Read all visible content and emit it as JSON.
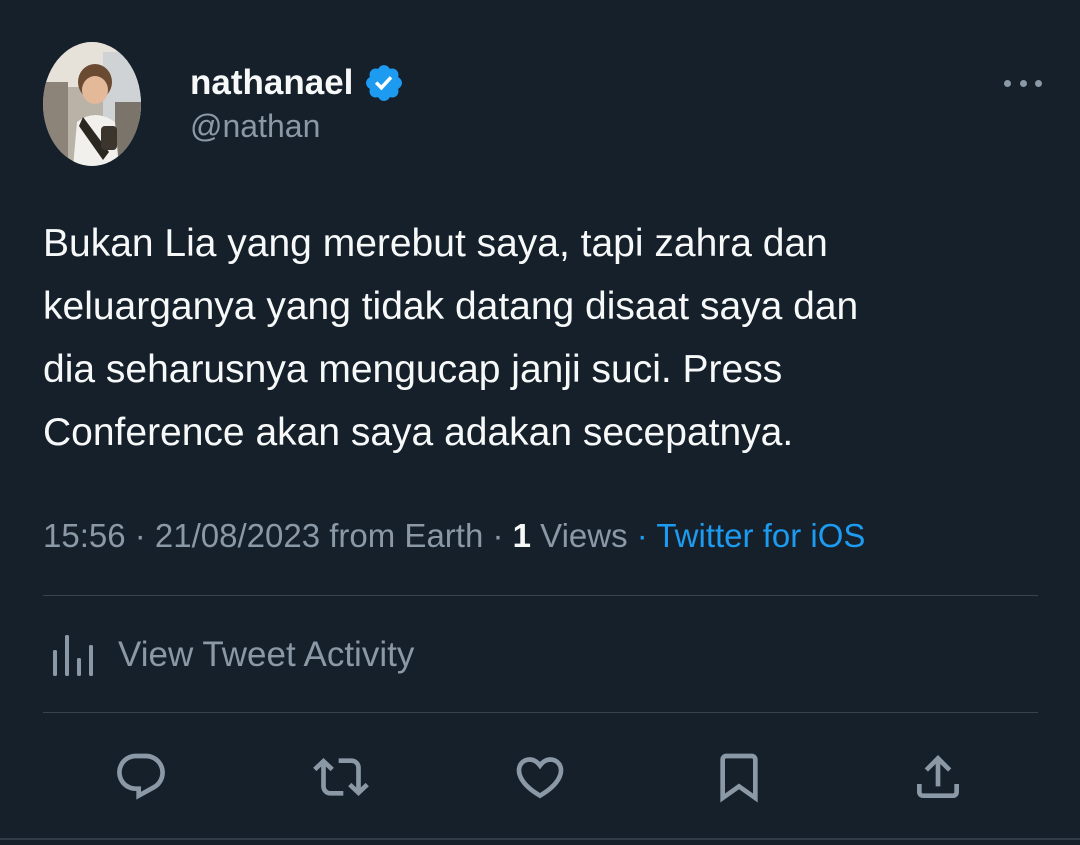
{
  "colors": {
    "background": "#15202b",
    "accent": "#1d9bf0",
    "secondary_text": "#8b98a5",
    "primary_text": "#f7f9f9",
    "divider": "#38444d"
  },
  "author": {
    "display_name": "nathanael",
    "handle": "@nathan",
    "verified": true,
    "avatar_icon": "profile-photo"
  },
  "tweet": {
    "text": "Bukan Lia yang merebut saya, tapi zahra dan\nkeluarganya yang tidak datang disaat saya dan\ndia seharusnya mengucap janji suci. Press\nConference akan saya adakan secepatnya."
  },
  "meta": {
    "time": "15:56",
    "separator": " · ",
    "date": "21/08/2023",
    "location": "from Earth",
    "views_count": "1",
    "views_label": "Views",
    "client": "Twitter for iOS"
  },
  "activity": {
    "label": "View Tweet Activity",
    "icon": "bar-chart-icon"
  },
  "actions": [
    {
      "name": "reply",
      "icon": "reply-icon"
    },
    {
      "name": "retweet",
      "icon": "retweet-icon"
    },
    {
      "name": "like",
      "icon": "heart-icon"
    },
    {
      "name": "bookmark",
      "icon": "bookmark-icon"
    },
    {
      "name": "share",
      "icon": "share-icon"
    }
  ]
}
